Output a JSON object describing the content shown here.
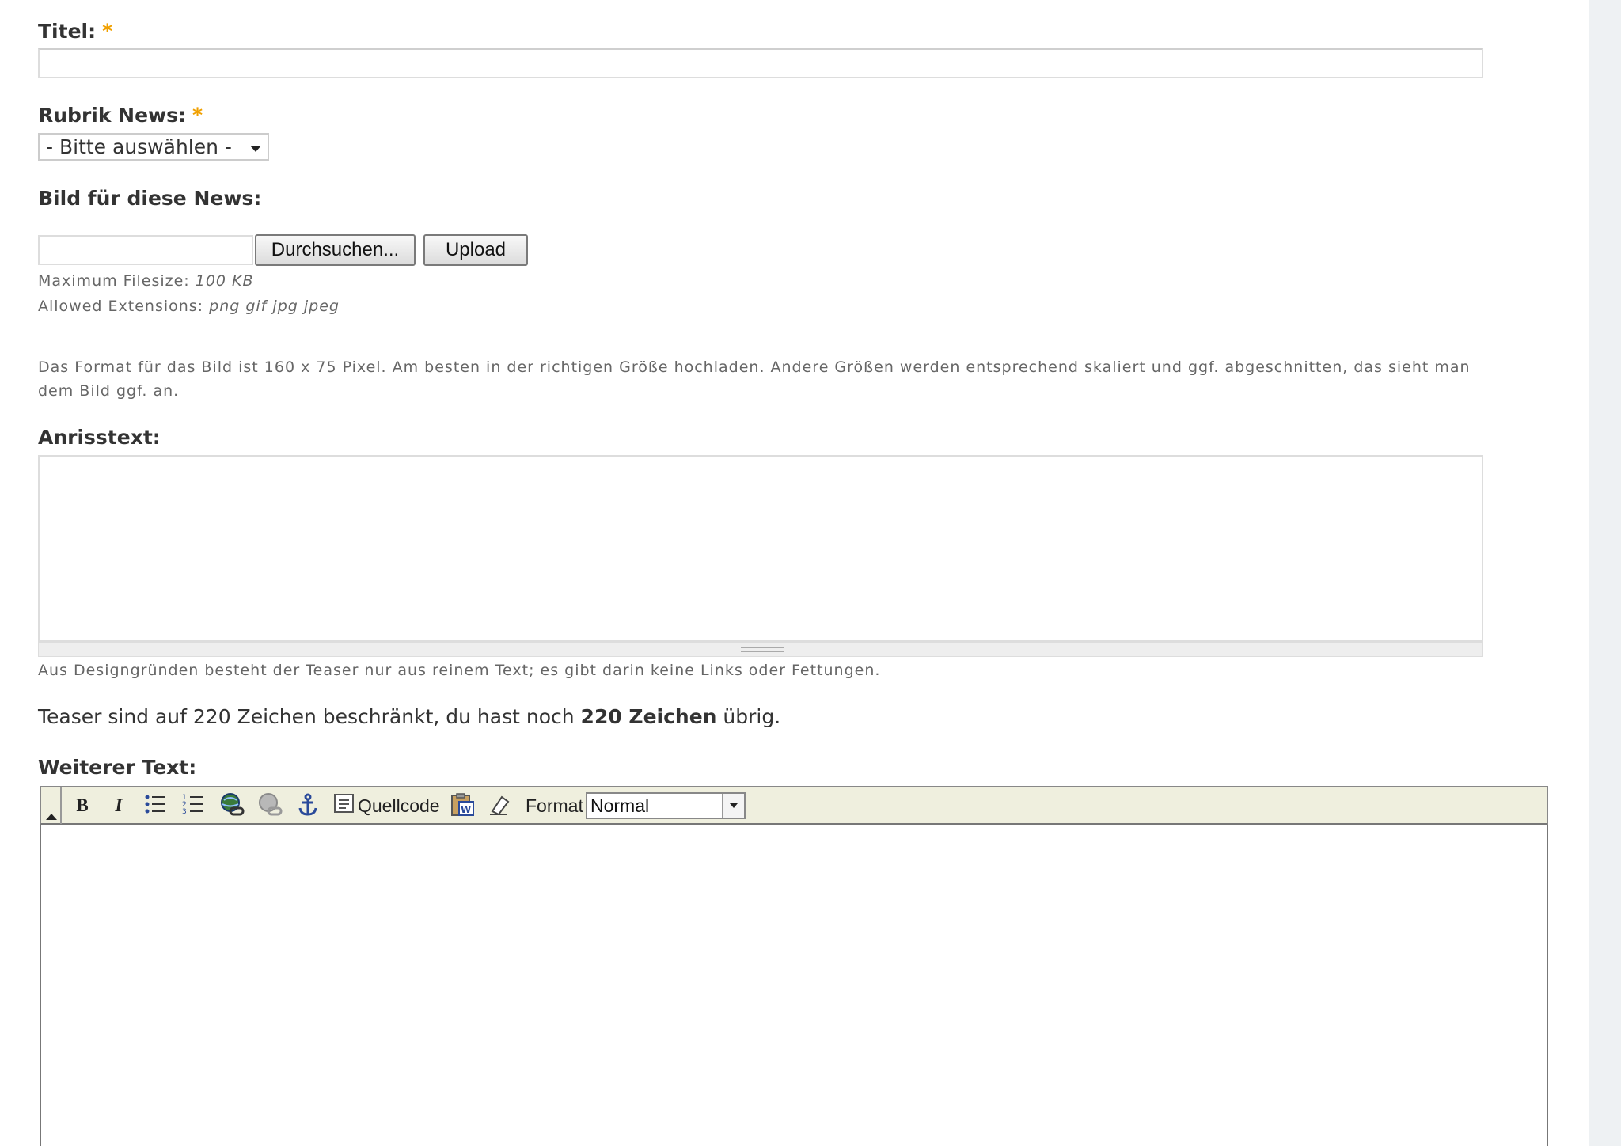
{
  "form": {
    "title_label": "Titel:",
    "required_mark": "*",
    "category_label": "Rubrik News:",
    "category_select_value": "- Bitte auswählen -",
    "image_label": "Bild für diese News:",
    "browse_button": "Durchsuchen...",
    "upload_button": "Upload",
    "max_filesize_label": "Maximum Filesize:",
    "max_filesize_value": "100 KB",
    "allowed_ext_label": "Allowed Extensions:",
    "allowed_ext_value": "png gif jpg jpeg",
    "image_hint_line1": "Das Format für das Bild ist 160 x 75 Pixel. Am besten in der richtigen Größe hochladen. Andere Größen werden entsprechend skaliert und ggf. abgeschnitten, das sieht man",
    "image_hint_line2": "dem Bild ggf. an.",
    "teaser_label": "Anrisstext:",
    "teaser_hint": "Aus Designgründen besteht der Teaser nur aus reinem Text; es gibt darin keine Links oder Fettungen.",
    "teaser_counter_prefix": "Teaser sind auf 220 Zeichen beschränkt, du hast noch",
    "teaser_counter_value": "220 Zeichen",
    "teaser_counter_suffix": "übrig.",
    "more_text_label": "Weiterer Text:"
  },
  "editor": {
    "bold": "B",
    "italic": "I",
    "source_label": "Quellcode",
    "format_label": "Format",
    "format_value": "Normal",
    "icons": [
      "collapse-toolbar-icon",
      "bold-icon",
      "italic-icon",
      "bulleted-list-icon",
      "numbered-list-icon",
      "insert-link-icon",
      "remove-link-icon",
      "anchor-icon",
      "source-icon",
      "paste-from-word-icon",
      "remove-format-icon",
      "dropdown-arrow-icon"
    ]
  },
  "colors": {
    "required": "#f0a000",
    "toolbar_bg": "#efefde",
    "right_bar": "#eef1f3"
  }
}
